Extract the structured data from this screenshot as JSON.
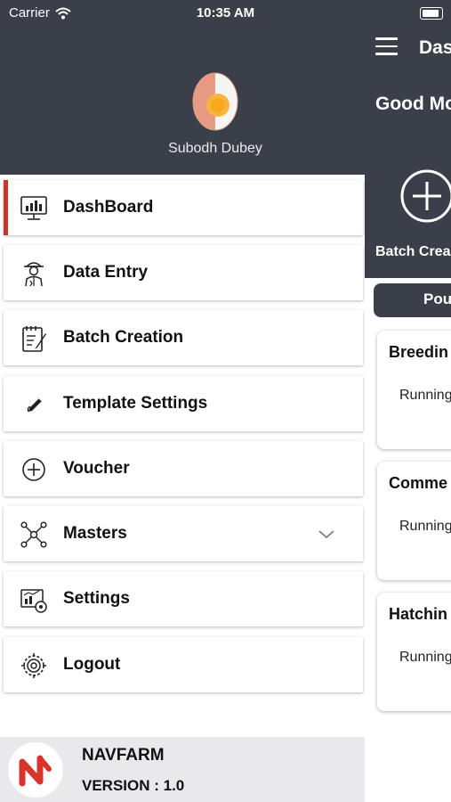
{
  "status_bar": {
    "carrier": "Carrier",
    "time": "10:35 AM",
    "wifi_icon": "wifi-icon",
    "battery_icon": "battery-icon"
  },
  "drawer": {
    "user_name": "Subodh Dubey",
    "avatar_icon": "egg-avatar-icon",
    "accent_color": "#c0392b",
    "header_color": "#3b3f4a",
    "items": [
      {
        "label": "DashBoard",
        "icon": "dashboard-icon",
        "active": true
      },
      {
        "label": "Data Entry",
        "icon": "farmer-icon"
      },
      {
        "label": "Batch Creation",
        "icon": "notepad-icon"
      },
      {
        "label": "Template Settings",
        "icon": "pen-icon"
      },
      {
        "label": "Voucher",
        "icon": "plus-circle-icon"
      },
      {
        "label": "Masters",
        "icon": "network-icon",
        "expandable": true
      },
      {
        "label": "Settings",
        "icon": "settings-chart-icon"
      },
      {
        "label": "Logout",
        "icon": "logout-gear-icon"
      }
    ],
    "footer": {
      "brand": "NAVFARM",
      "version": "VERSION : 1.0",
      "logo_icon": "navfarm-logo-icon"
    }
  },
  "background_screen": {
    "title": "Das",
    "greeting": "Good Mo",
    "batch_label": "Batch Crea",
    "tab_label": "Poult",
    "cards": [
      {
        "title": "Breedin",
        "status": "Running"
      },
      {
        "title": "Comme",
        "status": "Running"
      },
      {
        "title": "Hatchin",
        "status": "Running"
      }
    ]
  }
}
